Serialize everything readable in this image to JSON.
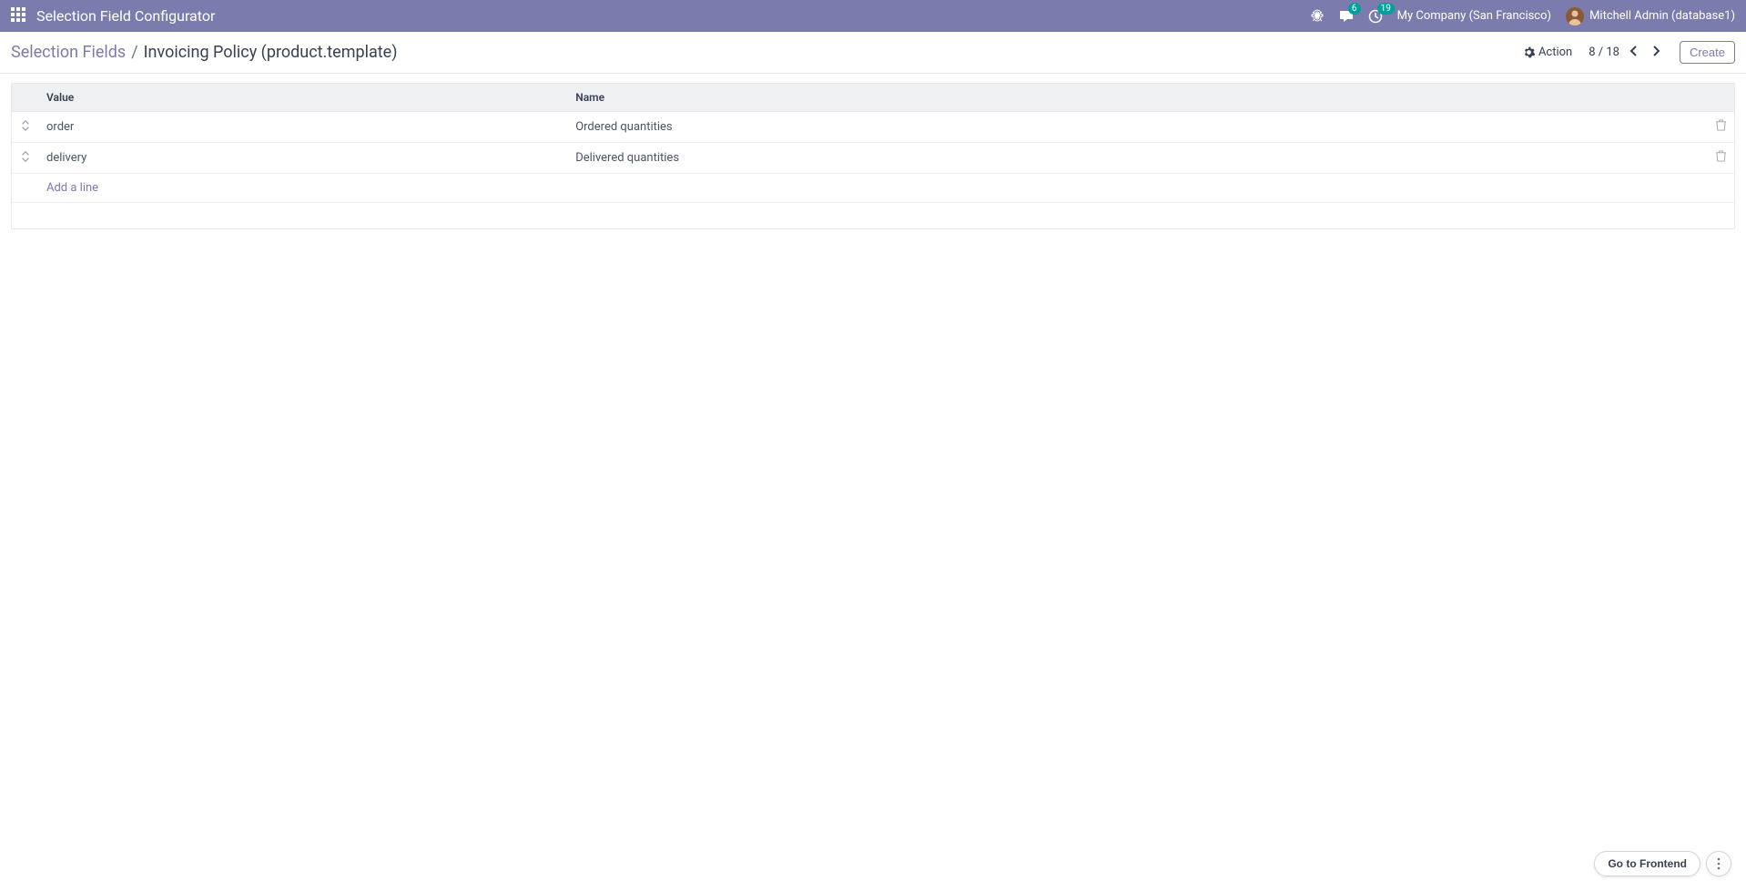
{
  "navbar": {
    "title": "Selection Field Configurator",
    "messages_count": "6",
    "activities_count": "19",
    "company": "My Company (San Francisco)",
    "user": "Mitchell Admin (database1)"
  },
  "breadcrumb": {
    "parent": "Selection Fields",
    "separator": "/",
    "current": "Invoicing Policy (product.template)"
  },
  "toolbar": {
    "action_label": "Action",
    "pager": "8 / 18",
    "create_label": "Create"
  },
  "table": {
    "headers": {
      "value": "Value",
      "name": "Name"
    },
    "rows": [
      {
        "value": "order",
        "name": "Ordered quantities"
      },
      {
        "value": "delivery",
        "name": "Delivered quantities"
      }
    ],
    "add_line": "Add a line"
  },
  "frontend": {
    "label": "Go to Frontend"
  }
}
